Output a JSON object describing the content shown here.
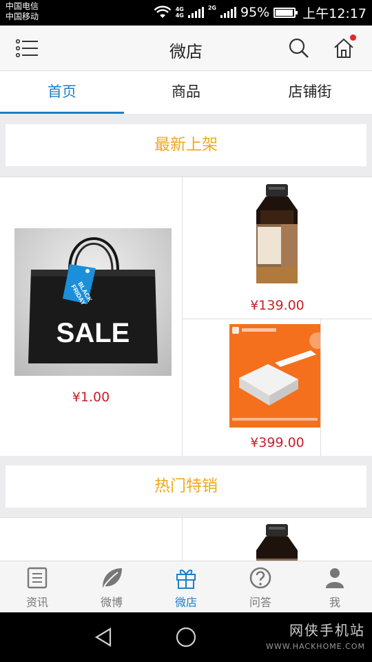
{
  "status_bar": {
    "carrier_1": "中国电信",
    "carrier_2": "中国移动",
    "network_1": "4G",
    "network_2": "2G",
    "battery_percent": "95%",
    "battery_level": 0.95,
    "time": "上午12:17"
  },
  "app_bar": {
    "title": "微店",
    "menu_icon": "list-menu-icon",
    "search_icon": "search-icon",
    "home_icon": "home-icon",
    "badge_color": "#e8232c"
  },
  "tabs": [
    {
      "label": "首页",
      "active": true
    },
    {
      "label": "商品",
      "active": false
    },
    {
      "label": "店铺街",
      "active": false
    }
  ],
  "sections": {
    "new_arrivals": {
      "title": "最新上架",
      "products": [
        {
          "image": "black-friday-sale-bag",
          "image_text": "SALE",
          "tag_text_1": "BLACK",
          "tag_text_2": "FRIDAY",
          "price": "¥1.00"
        },
        {
          "image": "body-shop-bottle",
          "price": "¥139.00"
        },
        {
          "image": "mi-box-product",
          "price": "¥399.00"
        }
      ]
    },
    "hot_sales": {
      "title": "热门特销"
    }
  },
  "bottom_nav": [
    {
      "label": "资讯",
      "icon": "news-icon",
      "active": false
    },
    {
      "label": "微博",
      "icon": "leaf-icon",
      "active": false
    },
    {
      "label": "微店",
      "icon": "gift-icon",
      "active": true
    },
    {
      "label": "问答",
      "icon": "question-icon",
      "active": false
    },
    {
      "label": "我",
      "icon": "person-icon",
      "active": false
    }
  ],
  "watermark": {
    "name": "网侠手机站",
    "url": "WWW.HACKHOME.COM"
  },
  "colors": {
    "accent": "#1a7fc9",
    "section_title": "#f0a81e",
    "price": "#c7202a"
  }
}
